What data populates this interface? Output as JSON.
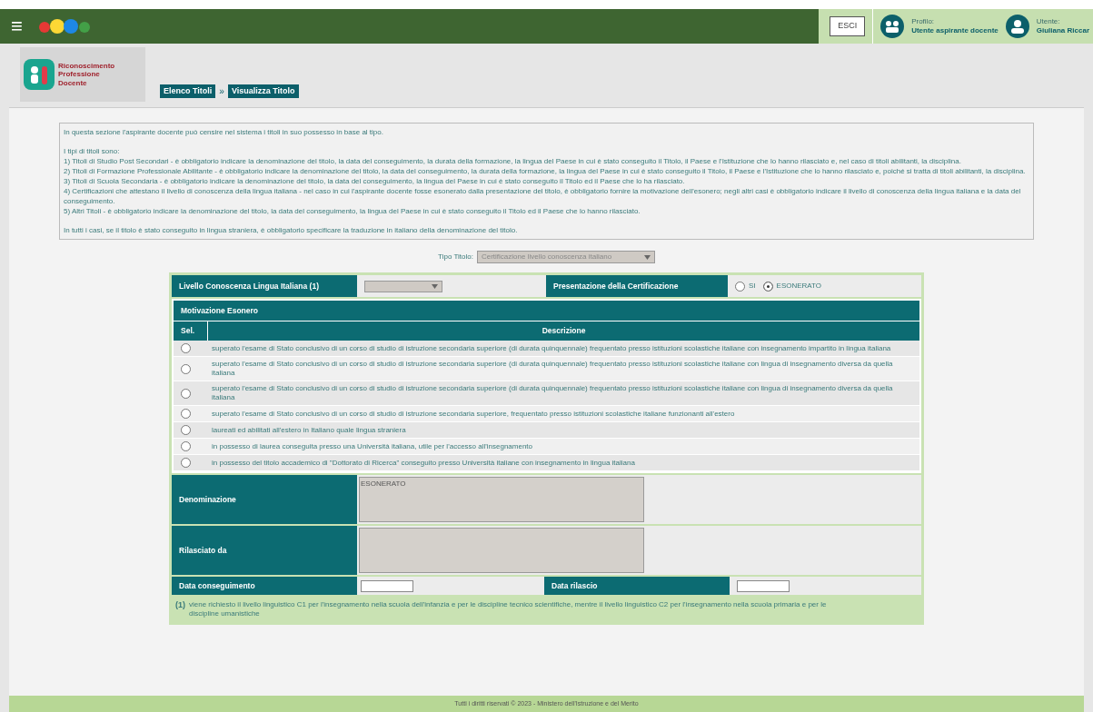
{
  "header": {
    "menu": "≡",
    "logout": "ESCI",
    "profile_label": "Profilo:",
    "profile_value": "Utente aspirante docente",
    "user_label": "Utente:",
    "user_value": "Giuliana Riccar"
  },
  "app_title": [
    "Riconoscimento",
    "Professione",
    "Docente"
  ],
  "breadcrumb": [
    {
      "label": "Elenco Titoli"
    },
    {
      "label": "Visualizza Titolo"
    }
  ],
  "breadcrumb_separator": "»",
  "intro": [
    "In questa sezione l'aspirante docente può censire nel sistema i titoli in suo possesso in base al tipo.",
    "I tipi di titoli sono:\n1) Titoli di Studio Post Secondari - è obbligatorio indicare la denominazione del titolo, la data del conseguimento, la durata della formazione, la lingua del Paese in cui è stato conseguito il Titolo, il Paese e l'Istituzione che lo hanno rilasciato e, nel caso di titoli abilitanti, la disciplina.\n2) Titoli di Formazione Professionale Abilitante - è obbligatorio indicare la denominazione del titolo, la data del conseguimento, la durata della formazione, la lingua del Paese in cui è stato conseguito il Titolo, il Paese e l'Istituzione che lo hanno rilasciato e, poiché si tratta di titoli abilitanti, la disciplina.\n3) Titoli di Scuola Secondaria - è obbligatorio indicare la denominazione del titolo, la data del conseguimento, la lingua del Paese in cui è stato conseguito il Titolo ed il Paese che lo ha rilasciato.\n4) Certificazioni che attestano il livello di conoscenza della lingua italiana - nel caso in cui l'aspirante docente fosse esonerato dalla presentazione del titolo, è obbligatorio fornire la motivazione dell'esonero; negli altri casi è obbligatorio indicare il livello di conoscenza della lingua italiana e la data del conseguimento.\n5) Altri Titoli - è obbligatorio indicare la denominazione del titolo, la data del conseguimento, la lingua del Paese in cui è stato conseguito il Titolo ed il Paese che lo hanno rilasciato.",
    "In tutti i casi, se il titolo è stato conseguito in lingua straniera, è obbligatorio specificare la traduzione in italiano della denominazione del titolo."
  ],
  "tipo_titolo": {
    "label": "Tipo Titolo:",
    "value": "Certificazione livello conoscenza italiano"
  },
  "livello": {
    "label": "Livello Conoscenza Lingua Italiana (1)"
  },
  "presentazione": {
    "label": "Presentazione della Certificazione",
    "options": [
      {
        "label": "SI",
        "selected": false
      },
      {
        "label": "ESONERATO",
        "selected": true
      }
    ]
  },
  "motivazione": {
    "title": "Motivazione Esonero",
    "columns": [
      "Sel.",
      "Descrizione"
    ],
    "rows": [
      {
        "selected": false,
        "text": "superato l'esame di Stato conclusivo di un corso di studio di istruzione secondaria superiore (di durata quinquennale) frequentato presso istituzioni scolastiche italiane con insegnamento impartito in lingua italiana"
      },
      {
        "selected": false,
        "text": "superato l'esame di Stato conclusivo di un corso di studio di istruzione secondaria superiore (di durata quinquennale) frequentato presso istituzioni scolastiche italiane con lingua di insegnamento diversa da quella italiana"
      },
      {
        "selected": false,
        "text": "superato l'esame di Stato conclusivo di un corso di studio di istruzione secondaria superiore (di durata quinquennale) frequentato presso istituzioni scolastiche italiane con lingua di insegnamento diversa da quella italiana"
      },
      {
        "selected": false,
        "text": "superato l'esame di Stato conclusivo di un corso di studio di istruzione secondaria superiore, frequentato presso istituzioni scolastiche italiane funzionanti all'estero"
      },
      {
        "selected": false,
        "text": "laureati ed abilitati all'estero in Italiano quale lingua straniera"
      },
      {
        "selected": false,
        "text": "in possesso di laurea conseguita presso una Università italiana, utile per l'accesso all'insegnamento"
      },
      {
        "selected": false,
        "text": "in possesso del titolo accademico di \"Dottorato di Ricerca\" conseguito presso Università italiane con insegnamento in lingua italiana"
      }
    ]
  },
  "denominazione": {
    "label": "Denominazione",
    "value": "ESONERATO"
  },
  "rilasciato_da": {
    "label": "Rilasciato da"
  },
  "data_conseguimento": {
    "label": "Data conseguimento"
  },
  "data_rilascio": {
    "label": "Data rilascio"
  },
  "note": {
    "mark": "(1)",
    "text": "viene richiesto il livello linguistico C1 per l'insegnamento nella scuola dell'infanzia e per le discipline tecnico scientifiche, mentre il livello linguistico C2 per l'insegnamento nella scuola primaria e per le discipline umanistiche"
  },
  "footer": "Tutti i diritti riservati © 2023 - Ministero dell'Istruzione e del Merito"
}
